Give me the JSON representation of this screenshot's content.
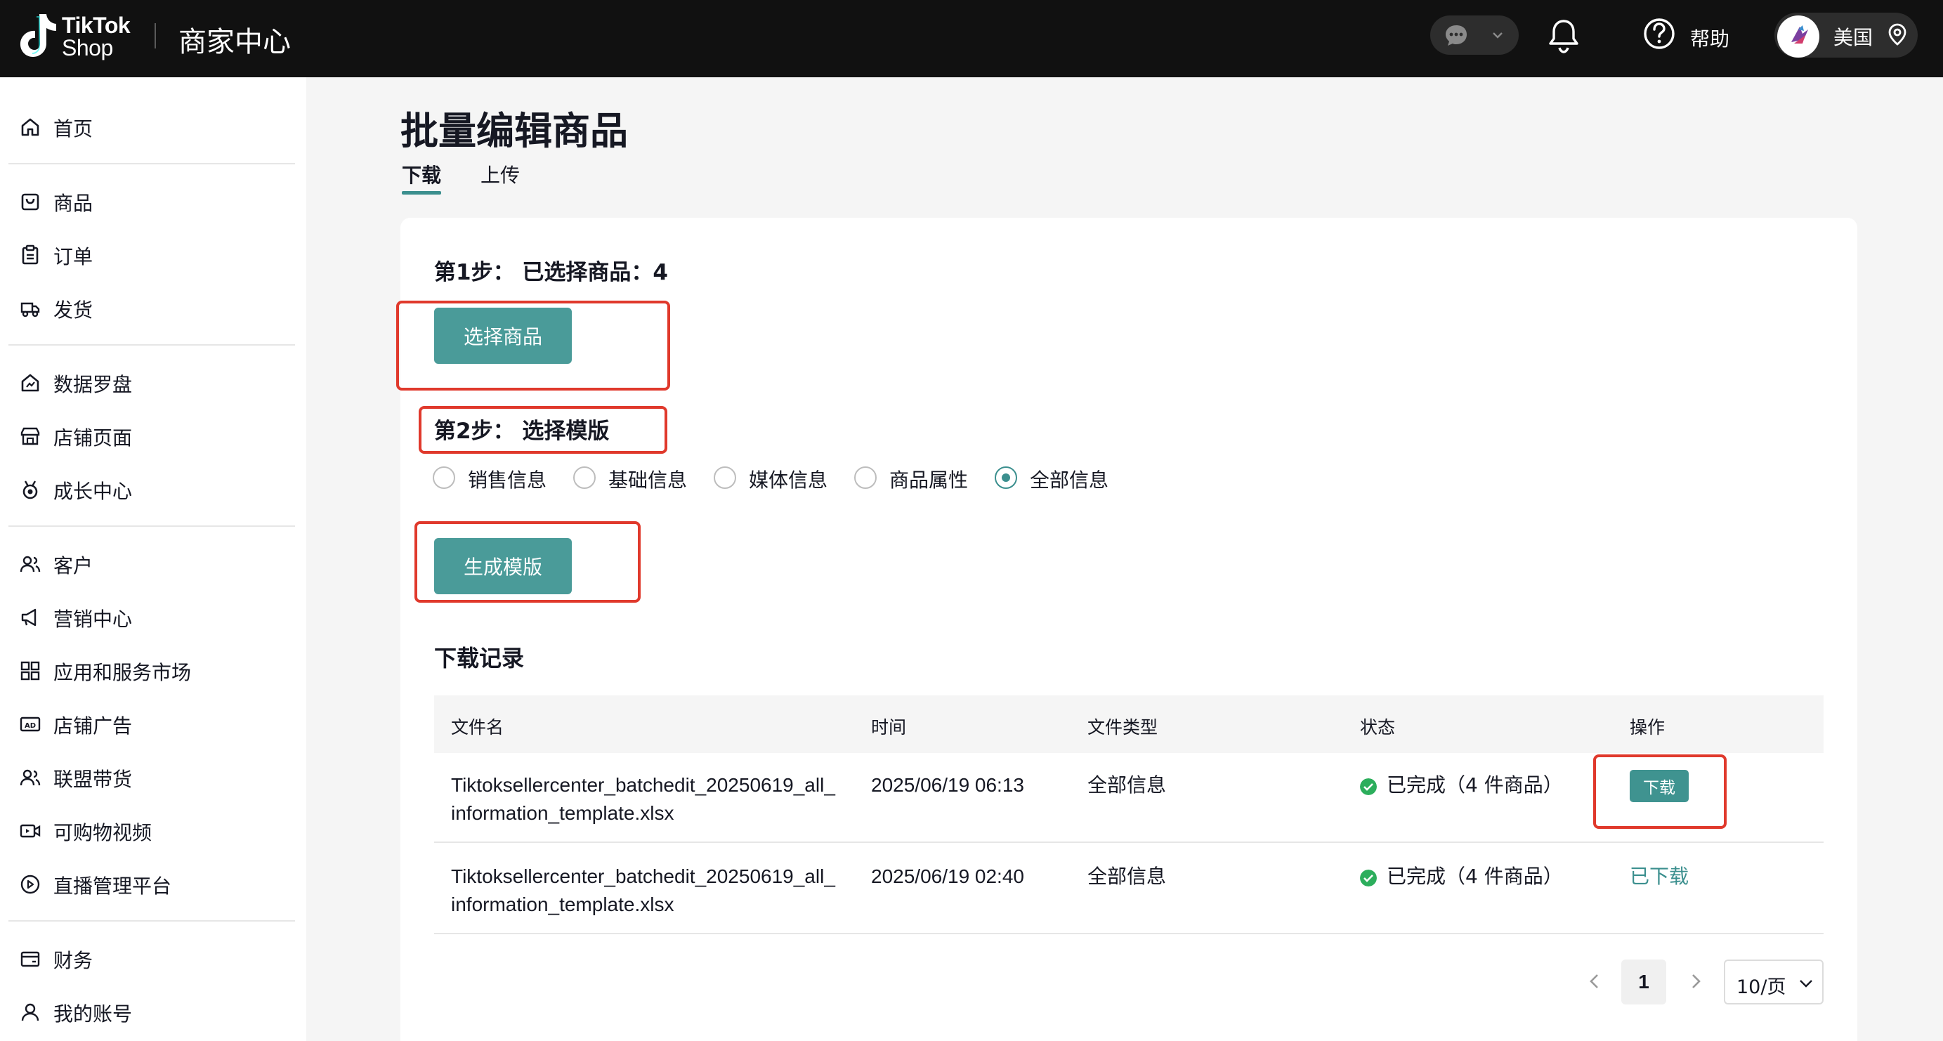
{
  "topbar": {
    "logo_line1": "TikTok",
    "logo_line2": "Shop",
    "title": "商家中心",
    "help_label": "帮助",
    "region_label": "美国"
  },
  "sidebar": {
    "items": [
      {
        "label": "首页",
        "icon": "home-icon"
      },
      {
        "label": "商品",
        "icon": "bag-icon"
      },
      {
        "label": "订单",
        "icon": "clipboard-icon"
      },
      {
        "label": "发货",
        "icon": "truck-icon"
      },
      {
        "label": "数据罗盘",
        "icon": "compass-icon"
      },
      {
        "label": "店铺页面",
        "icon": "store-icon"
      },
      {
        "label": "成长中心",
        "icon": "medal-icon"
      },
      {
        "label": "客户",
        "icon": "users-icon"
      },
      {
        "label": "营销中心",
        "icon": "megaphone-icon"
      },
      {
        "label": "应用和服务市场",
        "icon": "apps-icon"
      },
      {
        "label": "店铺广告",
        "icon": "ad-icon"
      },
      {
        "label": "联盟带货",
        "icon": "affiliate-icon"
      },
      {
        "label": "可购物视频",
        "icon": "video-icon"
      },
      {
        "label": "直播管理平台",
        "icon": "live-icon"
      },
      {
        "label": "财务",
        "icon": "wallet-icon"
      },
      {
        "label": "我的账号",
        "icon": "account-icon"
      }
    ]
  },
  "main": {
    "title": "批量编辑商品",
    "tabs": [
      {
        "label": "下载",
        "active": true
      },
      {
        "label": "上传",
        "active": false
      }
    ],
    "step1": {
      "title": "第1步： 已选择商品：4",
      "button": "选择商品"
    },
    "step2": {
      "title": "第2步： 选择模版",
      "options": [
        {
          "label": "销售信息",
          "checked": false
        },
        {
          "label": "基础信息",
          "checked": false
        },
        {
          "label": "媒体信息",
          "checked": false
        },
        {
          "label": "商品属性",
          "checked": false
        },
        {
          "label": "全部信息",
          "checked": true
        }
      ],
      "button": "生成模版"
    },
    "records": {
      "title": "下载记录",
      "columns": [
        "文件名",
        "时间",
        "文件类型",
        "状态",
        "操作"
      ],
      "rows": [
        {
          "filename_line1": "Tiktoksellercenter_batchedit_20250619_all_",
          "filename_line2": "information_template.xlsx",
          "time": "2025/06/19 06:13",
          "type": "全部信息",
          "status": "已完成（4 件商品）",
          "action": "下载"
        },
        {
          "filename_line1": "Tiktoksellercenter_batchedit_20250619_all_",
          "filename_line2": "information_template.xlsx",
          "time": "2025/06/19 02:40",
          "type": "全部信息",
          "status": "已完成（4 件商品）",
          "action": "已下载"
        }
      ]
    },
    "pagination": {
      "current_page": "1",
      "page_size": "10/页"
    }
  },
  "colors": {
    "accent": "#4a9b99",
    "highlight": "#e0392c",
    "success": "#2cae5c",
    "topbar_bg": "#111111"
  }
}
